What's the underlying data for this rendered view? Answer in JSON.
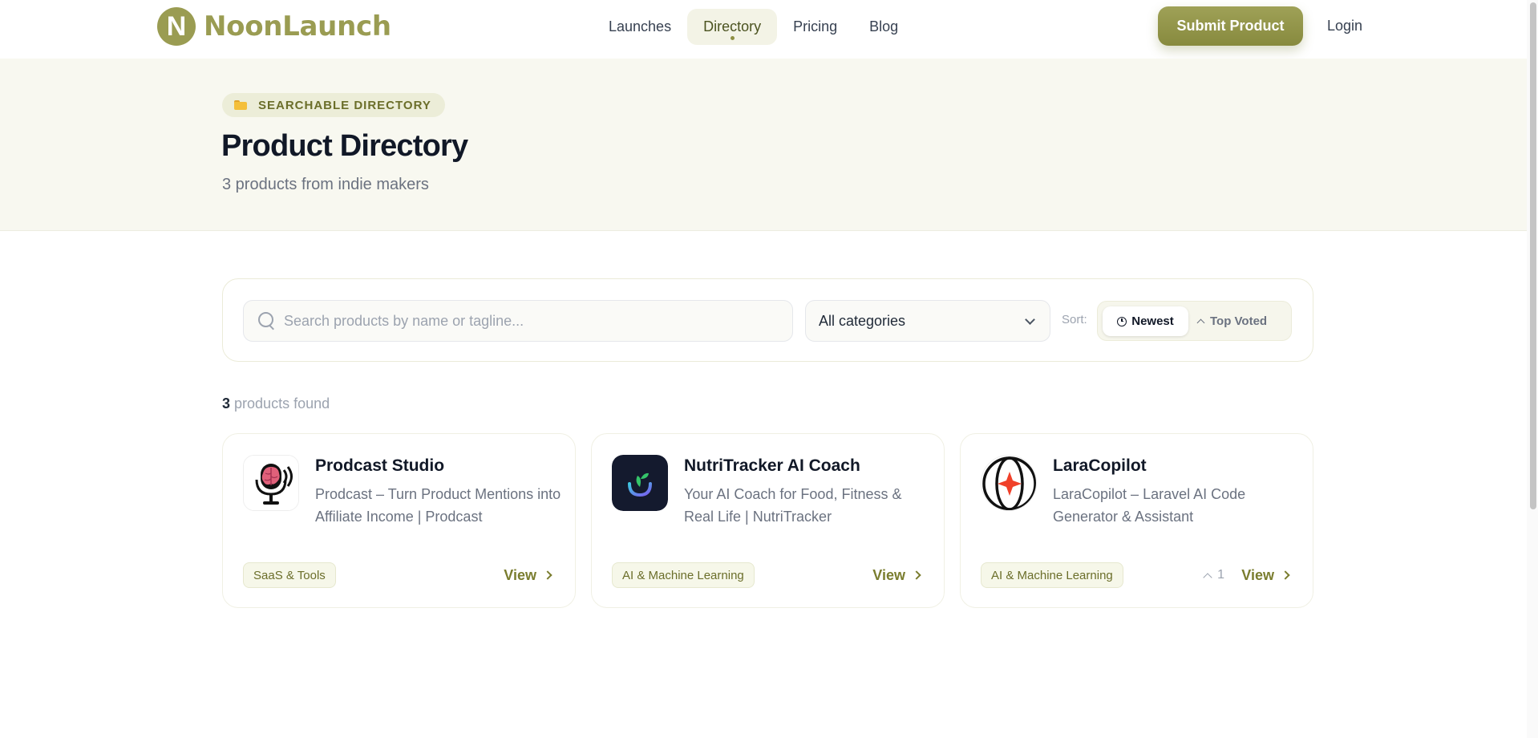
{
  "brand": {
    "logo_letter": "N",
    "name": "NoonLaunch"
  },
  "nav": {
    "items": [
      {
        "label": "Launches"
      },
      {
        "label": "Directory",
        "active": true
      },
      {
        "label": "Pricing"
      },
      {
        "label": "Blog"
      }
    ]
  },
  "header_actions": {
    "submit_label": "Submit Product",
    "login_label": "Login"
  },
  "hero": {
    "badge_icon": "folder-icon",
    "badge": "SEARCHABLE DIRECTORY",
    "title": "Product Directory",
    "subtitle": "3 products from indie makers"
  },
  "filters": {
    "search_placeholder": "Search products by name or tagline...",
    "search_value": "",
    "category_selected": "All categories",
    "sort_label": "Sort:",
    "sort_options": [
      {
        "label": "Newest",
        "icon": "clock-icon",
        "active": true
      },
      {
        "label": "Top Voted",
        "icon": "chevron-up-icon",
        "active": false
      }
    ]
  },
  "results": {
    "count": "3",
    "suffix": "products found"
  },
  "products": [
    {
      "name": "Prodcast Studio",
      "tagline": "Prodcast – Turn Product Mentions into Affiliate Income | Prodcast",
      "category": "SaaS & Tools",
      "logo": "microphone-brain-logo",
      "votes": "",
      "view_label": "View"
    },
    {
      "name": "NutriTracker AI Coach",
      "tagline": "Your AI Coach for Food, Fitness & Real Life | NutriTracker",
      "category": "AI & Machine Learning",
      "logo": "nutritracker-logo",
      "votes": "",
      "view_label": "View"
    },
    {
      "name": "LaraCopilot",
      "tagline": "LaraCopilot – Laravel AI Code Generator & Assistant",
      "category": "AI & Machine Learning",
      "logo": "laracopilot-logo",
      "votes": "1",
      "view_label": "View"
    }
  ],
  "colors": {
    "brand_olive": "#9a9c52",
    "brand_dark_olive": "#7a7d2f",
    "hero_bg": "#f8f8f0",
    "text_primary": "#111827",
    "text_muted": "#6b7280"
  }
}
